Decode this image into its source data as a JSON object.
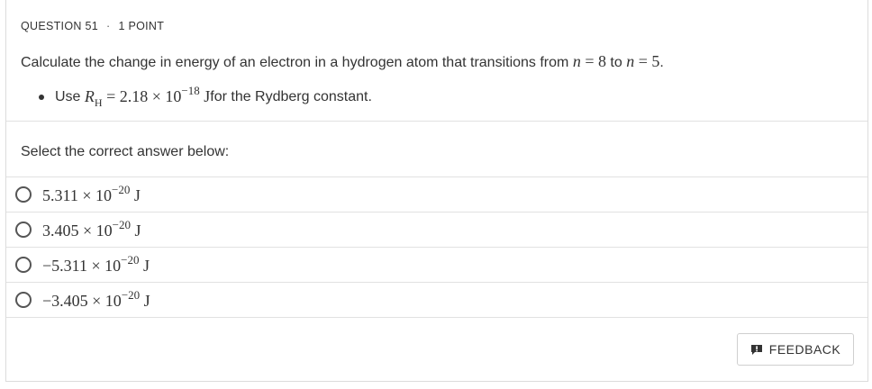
{
  "header": {
    "question_label": "QUESTION 51",
    "separator": "·",
    "points": "1 POINT"
  },
  "question": {
    "text_before": "Calculate the change in energy of an electron in a hydrogen atom that transitions from ",
    "n_var": "n",
    "eq": " = ",
    "n_initial": "8",
    "to_word": " to ",
    "n_final": "5",
    "period": "."
  },
  "hint": {
    "use_word": "Use ",
    "symbol": "R",
    "symbol_sub": "H",
    "equals": " = ",
    "mantissa": "2.18 × 10",
    "exponent": "−18",
    "unit": " J",
    "text_after": " for the Rydberg constant."
  },
  "prompt": "Select the correct answer below:",
  "options": [
    {
      "mantissa": "5.311 × 10",
      "exponent": "−20",
      "unit": " J"
    },
    {
      "mantissa": "3.405 × 10",
      "exponent": "−20",
      "unit": " J"
    },
    {
      "mantissa": "−5.311 × 10",
      "exponent": "−20",
      "unit": " J"
    },
    {
      "mantissa": "−3.405 × 10",
      "exponent": "−20",
      "unit": " J"
    }
  ],
  "feedback": {
    "label": "FEEDBACK",
    "icon": "feedback-icon"
  }
}
